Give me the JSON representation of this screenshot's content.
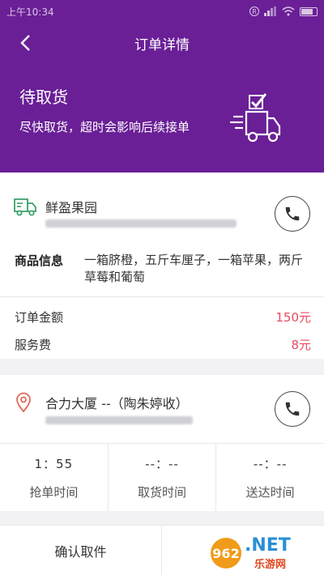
{
  "status_bar": {
    "time": "上午10:34",
    "r_badge": "R"
  },
  "nav": {
    "title": "订单详情"
  },
  "status": {
    "title": "待取货",
    "subtitle": "尽快取货，超时会影响后续接单"
  },
  "shop": {
    "name": "鲜盈果园",
    "goods_label": "商品信息",
    "goods_value": "一箱脐橙，五斤车厘子，一箱苹果，两斤草莓和葡萄"
  },
  "fees": [
    {
      "label": "订单金额",
      "value": "150元"
    },
    {
      "label": "服务费",
      "value": "8元"
    }
  ],
  "delivery": {
    "name": "合力大厦 --（陶朱婷收）"
  },
  "times": [
    {
      "value": "1：55",
      "label": "抢单时间"
    },
    {
      "value": "--：--",
      "label": "取货时间"
    },
    {
      "value": "--：--",
      "label": "送达时间"
    }
  ],
  "actions": {
    "confirm": "确认取件"
  },
  "watermark": {
    "badge": "962",
    "net": ".NET",
    "cn": "乐游网"
  },
  "colors": {
    "header": "#6a1f96",
    "price": "#e84a5f",
    "shop_icon": "#3aa26a",
    "location_icon": "#e06a5a"
  },
  "icons": {
    "back": "chevron-left-icon",
    "truck": "delivery-truck-icon",
    "shop": "shop-truck-icon",
    "location": "location-pin-icon",
    "phone": "phone-icon"
  }
}
